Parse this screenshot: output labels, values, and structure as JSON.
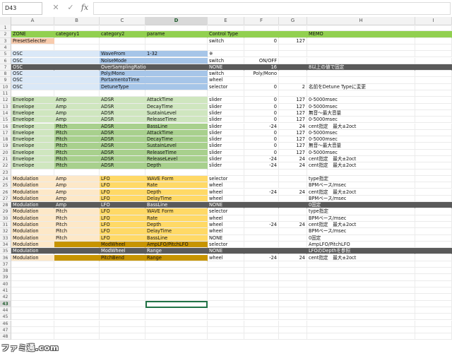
{
  "formula_bar": {
    "name_box": "D43",
    "cancel_icon": "✕",
    "enter_icon": "✓",
    "fx_label": "fx",
    "formula": ""
  },
  "columns": [
    "A",
    "B",
    "C",
    "D",
    "E",
    "F",
    "G",
    "H",
    "I"
  ],
  "selected_column": "D",
  "selected_row": 43,
  "row_count": 48,
  "colors": {
    "green": "#92d050",
    "gray": "#5a5a5a",
    "lightblue": "#dae8f7",
    "blue": "#a6c5e8",
    "lightgreen": "#cfe6bf",
    "green2": "#a8d08d",
    "lightorange": "#fde8c8",
    "yellow": "#ffd966",
    "darkgold": "#c79400",
    "salmon": "#f8cbad",
    "active": "#217346"
  },
  "rows": [
    {
      "r": 2,
      "fill": [
        "green",
        "green",
        "green",
        "green",
        "green",
        "green",
        "green",
        "green",
        "green"
      ],
      "cells": [
        "ZONE",
        "category1",
        "category2",
        "parame",
        "Control Type",
        "",
        "",
        "MEMO",
        ""
      ]
    },
    {
      "r": 3,
      "fill": [
        "salmon",
        "",
        "",
        "",
        "",
        "",
        "",
        "",
        ""
      ],
      "cells": [
        "PresetSelecter",
        "",
        "",
        "",
        "switch",
        "0",
        "127",
        "",
        ""
      ]
    },
    {
      "r": 5,
      "fill": [
        "lightblue",
        "lightblue",
        "blue",
        "blue",
        "",
        "",
        "",
        "",
        ""
      ],
      "cells": [
        "OSC",
        "",
        "WaveFrom",
        "1-32",
        "※",
        "",
        "",
        "",
        ""
      ]
    },
    {
      "r": 6,
      "fill": [
        "lightblue",
        "lightblue",
        "blue",
        "blue",
        "",
        "",
        "",
        "",
        ""
      ],
      "cells": [
        "OSC",
        "",
        "NoiseMode",
        "",
        "switch",
        "ON/OFF",
        "",
        "",
        ""
      ]
    },
    {
      "r": 7,
      "fill": [
        "gray",
        "gray",
        "gray",
        "gray",
        "gray",
        "gray",
        "gray",
        "gray",
        "gray"
      ],
      "cells": [
        "OSC",
        "",
        "OverSamplingRatio",
        "",
        "NONE",
        "16",
        "",
        "8以上の値で固定",
        ""
      ]
    },
    {
      "r": 8,
      "fill": [
        "lightblue",
        "lightblue",
        "blue",
        "blue",
        "",
        "",
        "",
        "",
        ""
      ],
      "cells": [
        "OSC",
        "",
        "Poly/Mono",
        "",
        "switch",
        "Poly/Mono",
        "",
        "",
        ""
      ]
    },
    {
      "r": 9,
      "fill": [
        "lightblue",
        "lightblue",
        "blue",
        "blue",
        "",
        "",
        "",
        "",
        ""
      ],
      "cells": [
        "OSC",
        "",
        "PortamentoTime",
        "",
        "wheel",
        "",
        "",
        "",
        ""
      ]
    },
    {
      "r": 10,
      "fill": [
        "lightblue",
        "lightblue",
        "blue",
        "blue",
        "",
        "",
        "",
        "",
        ""
      ],
      "cells": [
        "OSC",
        "",
        "DetuneType",
        "",
        "selector",
        "0",
        "2",
        "名前をDetune Typeに変更",
        ""
      ]
    },
    {
      "r": 12,
      "fill": [
        "lightgreen",
        "lightgreen",
        "lightgreen",
        "lightgreen",
        "",
        "",
        "",
        "",
        ""
      ],
      "cells": [
        "Envelope",
        "Amp",
        "ADSR",
        "AttackTime",
        "slider",
        "0",
        "127",
        "0-5000msec",
        ""
      ]
    },
    {
      "r": 13,
      "fill": [
        "lightgreen",
        "lightgreen",
        "lightgreen",
        "lightgreen",
        "",
        "",
        "",
        "",
        ""
      ],
      "cells": [
        "Envelope",
        "Amp",
        "ADSR",
        "DecayTime",
        "slider",
        "0",
        "127",
        "0-5000msec",
        ""
      ]
    },
    {
      "r": 14,
      "fill": [
        "lightgreen",
        "lightgreen",
        "lightgreen",
        "lightgreen",
        "",
        "",
        "",
        "",
        ""
      ],
      "cells": [
        "Envelope",
        "Amp",
        "ADSR",
        "SustainLevel",
        "slider",
        "0",
        "127",
        "無音～最大音量",
        ""
      ]
    },
    {
      "r": 15,
      "fill": [
        "lightgreen",
        "lightgreen",
        "lightgreen",
        "lightgreen",
        "",
        "",
        "",
        "",
        ""
      ],
      "cells": [
        "Envelope",
        "Amp",
        "ADSR",
        "ReleaseTime",
        "slider",
        "0",
        "127",
        "0-5000msec",
        ""
      ]
    },
    {
      "r": 16,
      "fill": [
        "lightgreen",
        "green2",
        "green2",
        "green2",
        "",
        "",
        "",
        "",
        ""
      ],
      "cells": [
        "Envelope",
        "Pitch",
        "ADSR",
        "BassLine",
        "slider",
        "-24",
        "24",
        "cent指定　最大±2oct",
        ""
      ]
    },
    {
      "r": 17,
      "fill": [
        "lightgreen",
        "green2",
        "green2",
        "green2",
        "",
        "",
        "",
        "",
        ""
      ],
      "cells": [
        "Envelope",
        "Pitch",
        "ADSR",
        "AttackTime",
        "slider",
        "0",
        "127",
        "0-5000msec",
        ""
      ]
    },
    {
      "r": 18,
      "fill": [
        "lightgreen",
        "green2",
        "green2",
        "green2",
        "",
        "",
        "",
        "",
        ""
      ],
      "cells": [
        "Envelope",
        "Pitch",
        "ADSR",
        "DecayTime",
        "slider",
        "0",
        "127",
        "0-5000msec",
        ""
      ]
    },
    {
      "r": 19,
      "fill": [
        "lightgreen",
        "green2",
        "green2",
        "green2",
        "",
        "",
        "",
        "",
        ""
      ],
      "cells": [
        "Envelope",
        "Pitch",
        "ADSR",
        "SustainLevel",
        "slider",
        "0",
        "127",
        "無音～最大音量",
        ""
      ]
    },
    {
      "r": 20,
      "fill": [
        "lightgreen",
        "green2",
        "green2",
        "green2",
        "",
        "",
        "",
        "",
        ""
      ],
      "cells": [
        "Envelope",
        "Pitch",
        "ADSR",
        "ReleaseTime",
        "slider",
        "0",
        "127",
        "0-5000msec",
        ""
      ]
    },
    {
      "r": 21,
      "fill": [
        "lightgreen",
        "green2",
        "green2",
        "green2",
        "",
        "",
        "",
        "",
        ""
      ],
      "cells": [
        "Envelope",
        "Pitch",
        "ADSR",
        "ReleaseLevel",
        "slider",
        "-24",
        "24",
        "cent指定　最大±2oct",
        ""
      ]
    },
    {
      "r": 22,
      "fill": [
        "lightgreen",
        "green2",
        "green2",
        "green2",
        "",
        "",
        "",
        "",
        ""
      ],
      "cells": [
        "Envelope",
        "Pitch",
        "ADSR",
        "Depth",
        "slider",
        "-24",
        "24",
        "cent指定　最大±2oct",
        ""
      ]
    },
    {
      "r": 24,
      "fill": [
        "lightorange",
        "lightorange",
        "yellow",
        "yellow",
        "",
        "",
        "",
        "",
        ""
      ],
      "cells": [
        "Modulation",
        "Amp",
        "LFO",
        "WAVE Form",
        "selector",
        "",
        "",
        "type指定",
        ""
      ]
    },
    {
      "r": 25,
      "fill": [
        "lightorange",
        "lightorange",
        "yellow",
        "yellow",
        "",
        "",
        "",
        "",
        ""
      ],
      "cells": [
        "Modulation",
        "Amp",
        "LFO",
        "Rate",
        "wheel",
        "",
        "",
        "BPMベース/msec",
        ""
      ]
    },
    {
      "r": 26,
      "fill": [
        "lightorange",
        "lightorange",
        "yellow",
        "yellow",
        "",
        "",
        "",
        "",
        ""
      ],
      "cells": [
        "Modulation",
        "Amp",
        "LFO",
        "Depth",
        "wheel",
        "-24",
        "24",
        "cent指定　最大±2oct",
        ""
      ]
    },
    {
      "r": 27,
      "fill": [
        "lightorange",
        "lightorange",
        "yellow",
        "yellow",
        "",
        "",
        "",
        "",
        ""
      ],
      "cells": [
        "Modulation",
        "Amp",
        "LFO",
        "DelayTime",
        "wheel",
        "",
        "",
        "BPMベース/msec",
        ""
      ]
    },
    {
      "r": 28,
      "fill": [
        "gray",
        "gray",
        "gray",
        "gray",
        "gray",
        "gray",
        "gray",
        "gray",
        "gray"
      ],
      "cells": [
        "Modulation",
        "Amp",
        "LFO",
        "BassLine",
        "NONE",
        "",
        "",
        "0固定",
        ""
      ]
    },
    {
      "r": 29,
      "fill": [
        "lightorange",
        "lightorange",
        "yellow",
        "yellow",
        "",
        "",
        "",
        "",
        ""
      ],
      "cells": [
        "Modulation",
        "Pitch",
        "LFO",
        "WAVE Form",
        "selector",
        "",
        "",
        "type指定",
        ""
      ]
    },
    {
      "r": 30,
      "fill": [
        "lightorange",
        "lightorange",
        "yellow",
        "yellow",
        "",
        "",
        "",
        "",
        ""
      ],
      "cells": [
        "Modulation",
        "Pitch",
        "LFO",
        "Rate",
        "wheel",
        "",
        "",
        "BPMベース/msec",
        ""
      ]
    },
    {
      "r": 31,
      "fill": [
        "lightorange",
        "lightorange",
        "yellow",
        "yellow",
        "",
        "",
        "",
        "",
        ""
      ],
      "cells": [
        "Modulation",
        "Pitch",
        "LFO",
        "Depth",
        "wheel",
        "-24",
        "24",
        "cent指定　最大±2oct",
        ""
      ]
    },
    {
      "r": 32,
      "fill": [
        "lightorange",
        "lightorange",
        "yellow",
        "yellow",
        "",
        "",
        "",
        "",
        ""
      ],
      "cells": [
        "Modulation",
        "Pitch",
        "LFO",
        "DelayTime",
        "wheel",
        "",
        "",
        "BPMベース/msec",
        ""
      ]
    },
    {
      "r": 33,
      "fill": [
        "lightorange",
        "lightorange",
        "yellow",
        "yellow",
        "",
        "",
        "",
        "",
        ""
      ],
      "cells": [
        "Modulation",
        "Pitch",
        "LFO",
        "BassLine",
        "NONE",
        "",
        "",
        "0固定",
        ""
      ]
    },
    {
      "r": 34,
      "fill": [
        "lightorange",
        "darkgold",
        "darkgold",
        "darkgold",
        "",
        "",
        "",
        "",
        ""
      ],
      "cells": [
        "Modulation",
        "",
        "ModWheel",
        "AmpLFO/PitchLFO",
        "selector",
        "",
        "",
        "AmpLFO/PitchLFO",
        ""
      ]
    },
    {
      "r": 35,
      "fill": [
        "gray",
        "gray",
        "gray",
        "gray",
        "gray",
        "gray",
        "gray",
        "gray",
        "gray"
      ],
      "cells": [
        "Modulation",
        "",
        "ModWheel",
        "Range",
        "NONE",
        "",
        "",
        "LFOのDepthを参照",
        ""
      ]
    },
    {
      "r": 36,
      "fill": [
        "lightorange",
        "darkgold",
        "darkgold",
        "darkgold",
        "",
        "",
        "",
        "",
        ""
      ],
      "cells": [
        "Modulation",
        "",
        "PitchBend",
        "Range",
        "wheel",
        "-24",
        "24",
        "cent指定　最大±2oct",
        ""
      ]
    }
  ],
  "watermark": "ファミ通.com"
}
